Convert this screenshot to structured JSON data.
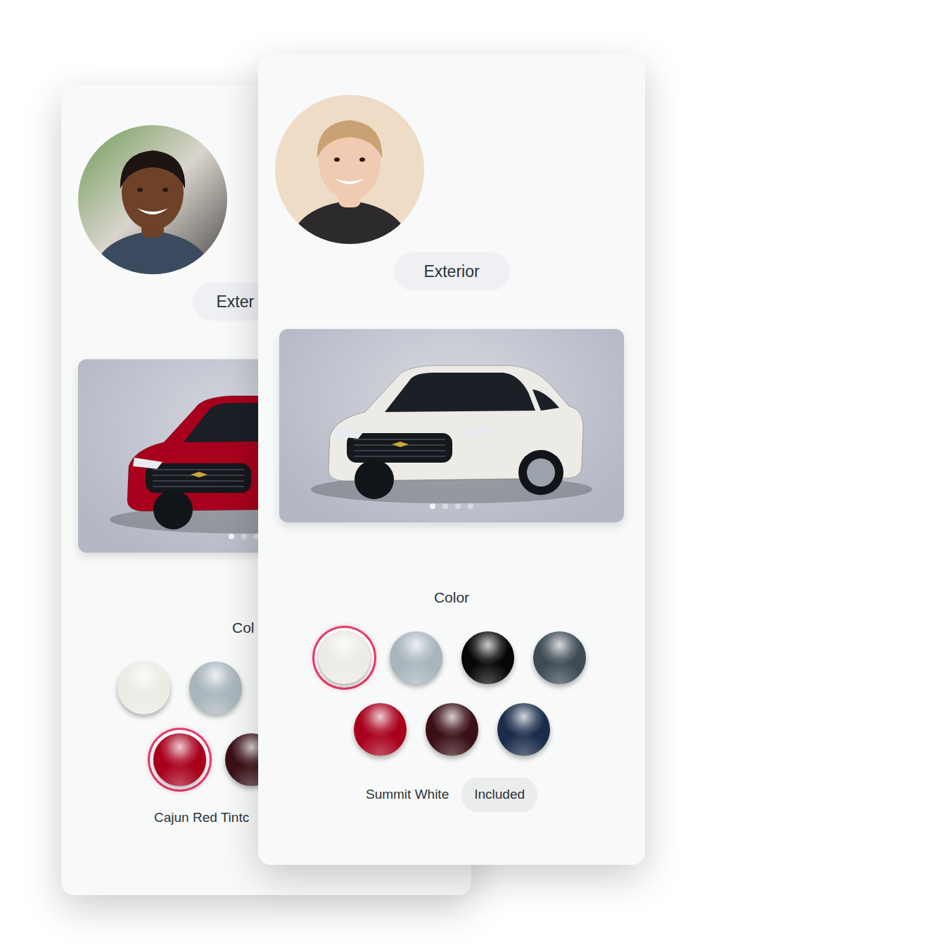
{
  "back_card": {
    "section": "Exter",
    "carousel": [
      {
        "selected": true
      },
      {
        "selected": false
      },
      {
        "selected": false
      }
    ],
    "color_heading": "Col",
    "swatch_rows": [
      [
        {
          "color": "#ecebe6",
          "selected": false
        },
        {
          "color": "#a9b5bd",
          "selected": false
        }
      ],
      [
        {
          "color": "#a8001c",
          "selected": true
        },
        {
          "color": "#3a1016",
          "selected": false
        }
      ]
    ],
    "color_name": "Cajun Red Tintc"
  },
  "front_card": {
    "section": "Exterior",
    "carousel": [
      {
        "selected": true
      },
      {
        "selected": false
      },
      {
        "selected": false
      },
      {
        "selected": false
      }
    ],
    "color_heading": "Color",
    "swatch_rows": [
      [
        {
          "color": "#ecebe6",
          "selected": true
        },
        {
          "color": "#a9b5bd",
          "selected": false
        },
        {
          "color": "#060606",
          "selected": false
        },
        {
          "color": "#3d4b55",
          "selected": false
        }
      ],
      [
        {
          "color": "#a8001c",
          "selected": false
        },
        {
          "color": "#3a1016",
          "selected": false
        },
        {
          "color": "#1c2d4b",
          "selected": false
        }
      ]
    ],
    "color_name": "Summit White",
    "price_badge": "Included"
  }
}
